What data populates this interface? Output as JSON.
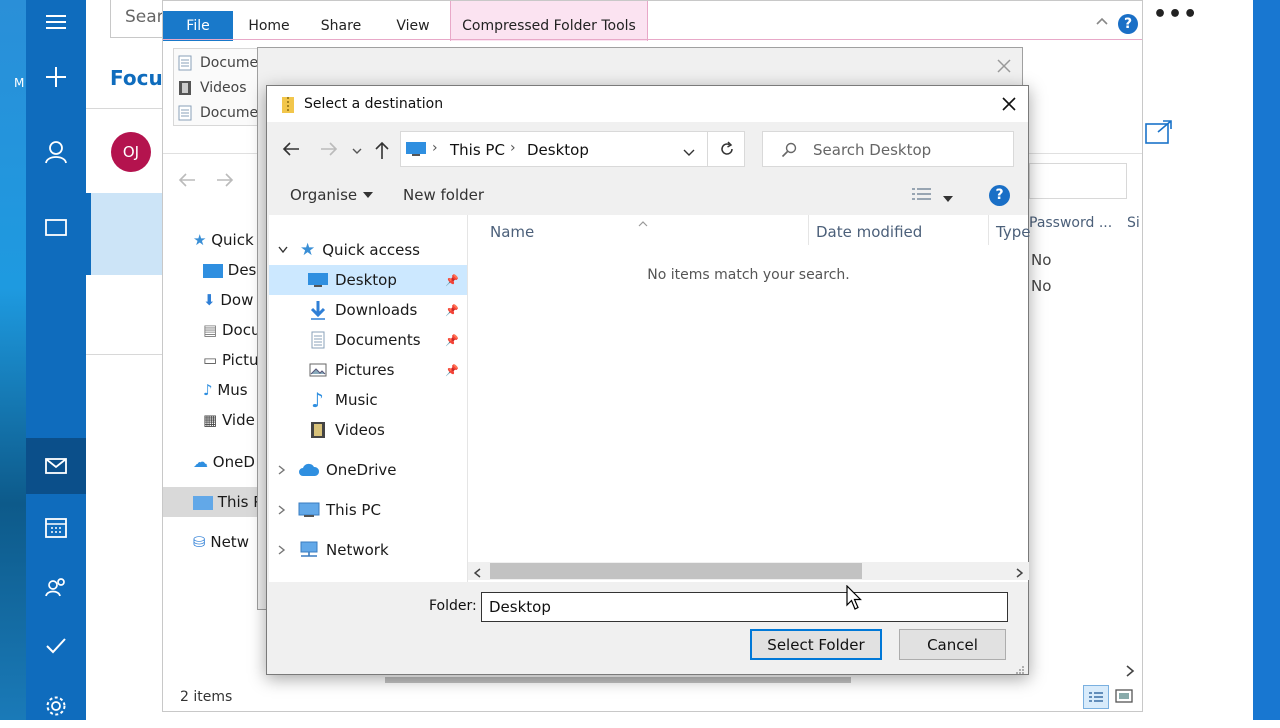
{
  "mail": {
    "search_placeholder": "Sear",
    "focus_label": "Focus",
    "avatar_initials": "OJ",
    "rail_badge": "M"
  },
  "explorer": {
    "ribbon_tabs": {
      "file": "File",
      "home": "Home",
      "share": "Share",
      "view": "View",
      "compressed": "Compressed Folder Tools"
    },
    "recent_items": [
      "Documen",
      "Videos",
      "Documen"
    ],
    "nav_items": [
      "Quick",
      "Desk",
      "Dow",
      "Docu",
      "Pictu",
      "Mus",
      "Vide",
      "OneD",
      "This P",
      "Netw"
    ],
    "columns": {
      "password": "Password ...",
      "size": "Si"
    },
    "password_values": [
      "No",
      "No"
    ],
    "status": "2 items"
  },
  "dialog": {
    "title": "Select a destination",
    "breadcrumb": [
      "This PC",
      "Desktop"
    ],
    "search_placeholder": "Search Desktop",
    "toolbar": {
      "organise": "Organise",
      "new_folder": "New folder"
    },
    "columns": {
      "name": "Name",
      "date": "Date modified",
      "type": "Type"
    },
    "empty_message": "No items match your search.",
    "nav": {
      "quick_access": "Quick access",
      "desktop": "Desktop",
      "downloads": "Downloads",
      "documents": "Documents",
      "pictures": "Pictures",
      "music": "Music",
      "videos": "Videos",
      "onedrive": "OneDrive",
      "thispc": "This PC",
      "network": "Network"
    },
    "folder_label": "Folder:",
    "folder_value": "Desktop",
    "select_button": "Select Folder",
    "cancel_button": "Cancel"
  },
  "colors": {
    "accent": "#0f6cbd",
    "file_tab": "#1979ca",
    "compressed_tab": "#fbe3f1",
    "selection": "#cce8ff"
  }
}
